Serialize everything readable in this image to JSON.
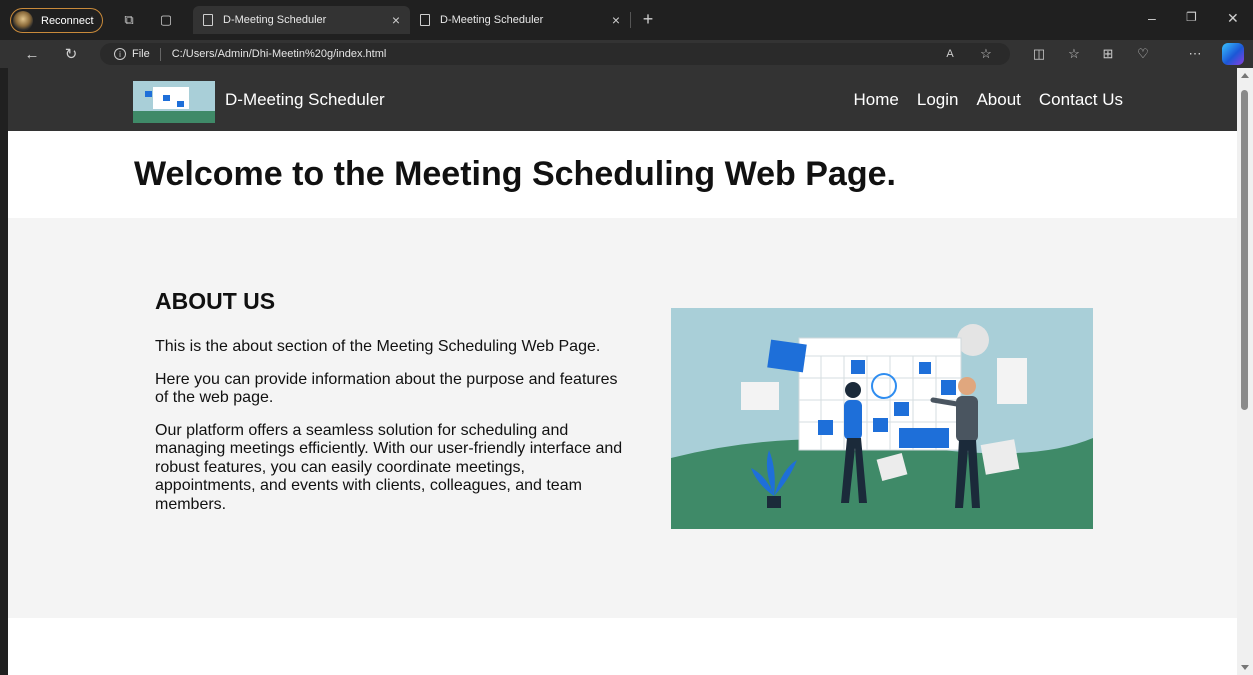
{
  "browser": {
    "profile_label": "Reconnect",
    "tabs": [
      {
        "title": "D-Meeting Scheduler",
        "active": true
      },
      {
        "title": "D-Meeting Scheduler",
        "active": false
      }
    ],
    "new_tab_symbol": "+",
    "address": {
      "scheme_label": "File",
      "url": "C:/Users/Admin/Dhi-Meetin%20g/index.html"
    }
  },
  "site": {
    "brand": "D-Meeting Scheduler",
    "nav": [
      {
        "label": "Home"
      },
      {
        "label": "Login"
      },
      {
        "label": "About"
      },
      {
        "label": "Contact Us"
      }
    ],
    "hero_title": "Welcome to the Meeting Scheduling Web Page.",
    "about": {
      "heading": "ABOUT US",
      "paragraphs": [
        "This is the about section of the Meeting Scheduling Web Page.",
        "Here you can provide information about the purpose and features of the web page.",
        "Our platform offers a seamless solution for scheduling and managing meetings efficiently. With our user-friendly interface and robust features, you can easily coordinate meetings, appointments, and events with clients, colleagues, and team members."
      ]
    }
  },
  "colors": {
    "nav_bg": "#333333",
    "section_bg": "#f4f4f4",
    "illustration_sky": "#a9cfd8",
    "illustration_ground": "#3f8a68",
    "accent_blue": "#1e6fd9"
  }
}
